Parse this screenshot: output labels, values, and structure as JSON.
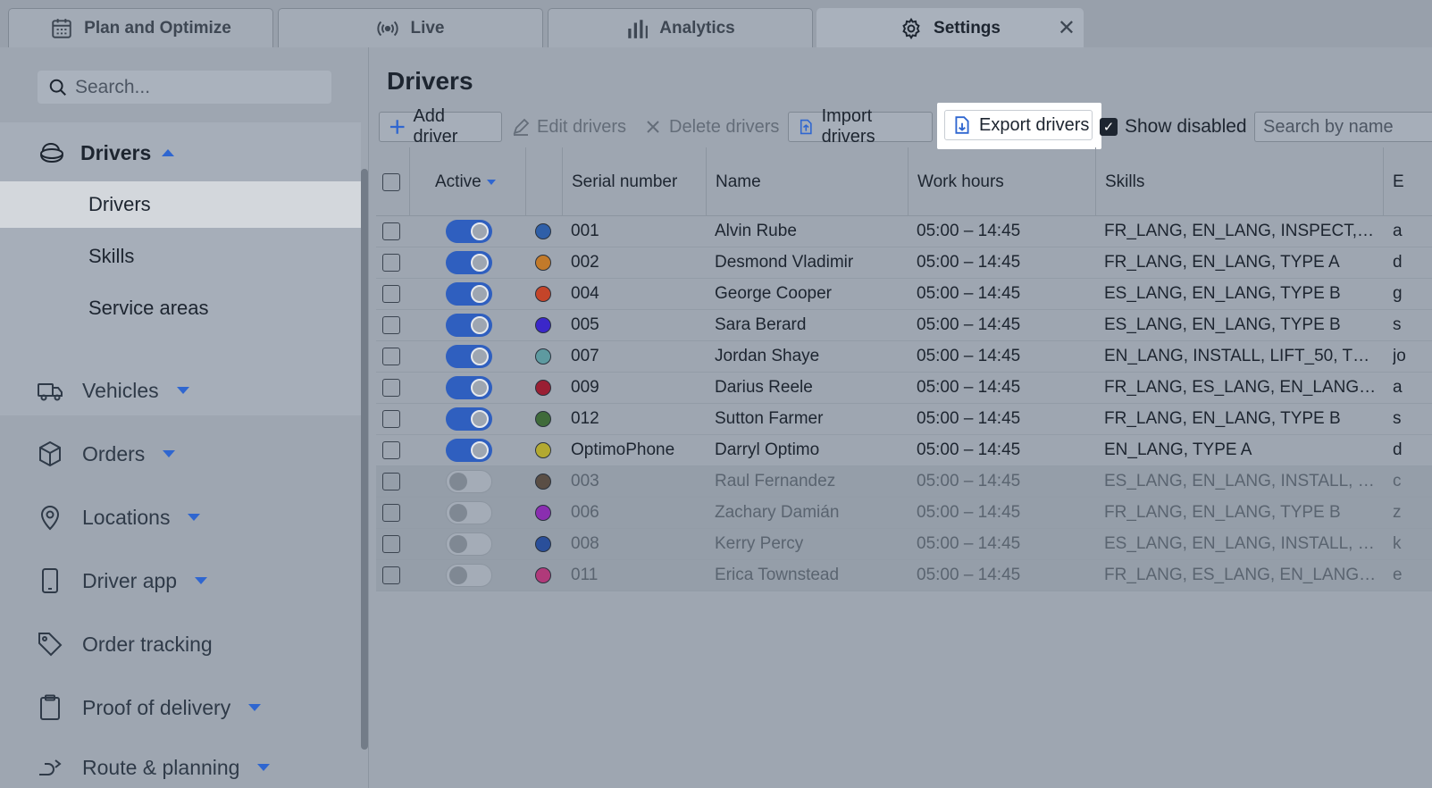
{
  "tabs": [
    {
      "label": "Plan and Optimize",
      "icon": "calendar-icon"
    },
    {
      "label": "Live",
      "icon": "broadcast-icon"
    },
    {
      "label": "Analytics",
      "icon": "bar-chart-icon"
    },
    {
      "label": "Settings",
      "icon": "gear-icon",
      "active": true,
      "close": "✕"
    }
  ],
  "sidebar": {
    "search_placeholder": "Search...",
    "group": {
      "label": "Drivers",
      "items": [
        "Drivers",
        "Skills",
        "Service areas"
      ]
    },
    "nav": [
      {
        "label": "Vehicles",
        "icon": "truck-icon"
      },
      {
        "label": "Orders",
        "icon": "box-icon"
      },
      {
        "label": "Locations",
        "icon": "map-pin-icon"
      },
      {
        "label": "Driver app",
        "icon": "phone-icon"
      },
      {
        "label": "Order tracking",
        "icon": "tag-icon"
      },
      {
        "label": "Proof of delivery",
        "icon": "clipboard-icon"
      },
      {
        "label": "Route & planning",
        "icon": "route-icon"
      }
    ]
  },
  "main": {
    "title": "Drivers",
    "toolbar": {
      "add": "Add driver",
      "edit": "Edit drivers",
      "delete": "Delete drivers",
      "import": "Import drivers",
      "export": "Export drivers",
      "show_disabled": "Show disabled",
      "search_placeholder": "Search by name"
    },
    "columns": [
      "Active",
      "Serial number",
      "Name",
      "Work hours",
      "Skills",
      "E"
    ],
    "rows": [
      {
        "active": true,
        "color": "#2f5fa8",
        "serial": "001",
        "name": "Alvin Rube",
        "hours": "05:00 – 14:45",
        "skills": "FR_LANG, EN_LANG, INSPECT,…",
        "extra": "a"
      },
      {
        "active": true,
        "color": "#c27a2a",
        "serial": "002",
        "name": "Desmond Vladimir",
        "hours": "05:00 – 14:45",
        "skills": "FR_LANG, EN_LANG, TYPE A",
        "extra": "d"
      },
      {
        "active": true,
        "color": "#c4452a",
        "serial": "004",
        "name": "George Cooper",
        "hours": "05:00 – 14:45",
        "skills": "ES_LANG, EN_LANG, TYPE B",
        "extra": "g"
      },
      {
        "active": true,
        "color": "#3b27c9",
        "serial": "005",
        "name": "Sara Berard",
        "hours": "05:00 – 14:45",
        "skills": "ES_LANG, EN_LANG, TYPE B",
        "extra": "s"
      },
      {
        "active": true,
        "color": "#5e9aa0",
        "serial": "007",
        "name": "Jordan Shaye",
        "hours": "05:00 – 14:45",
        "skills": "EN_LANG, INSTALL, LIFT_50, T…",
        "extra": "jo"
      },
      {
        "active": true,
        "color": "#9a1f33",
        "serial": "009",
        "name": "Darius Reele",
        "hours": "05:00 – 14:45",
        "skills": "FR_LANG, ES_LANG, EN_LANG…",
        "extra": "a"
      },
      {
        "active": true,
        "color": "#3f6b3a",
        "serial": "012",
        "name": "Sutton Farmer",
        "hours": "05:00 – 14:45",
        "skills": "FR_LANG, EN_LANG, TYPE B",
        "extra": "s"
      },
      {
        "active": true,
        "color": "#b3a931",
        "serial": "OptimoPhone",
        "name": "Darryl Optimo",
        "hours": "05:00 – 14:45",
        "skills": "EN_LANG, TYPE A",
        "extra": "d"
      },
      {
        "active": false,
        "color": "#5a4e45",
        "serial": "003",
        "name": "Raul Fernandez",
        "hours": "05:00 – 14:45",
        "skills": "ES_LANG, EN_LANG, INSTALL, …",
        "extra": "c"
      },
      {
        "active": false,
        "color": "#8a2eb0",
        "serial": "006",
        "name": "Zachary Damián",
        "hours": "05:00 – 14:45",
        "skills": "FR_LANG, EN_LANG, TYPE B",
        "extra": "z"
      },
      {
        "active": false,
        "color": "#2a4f9a",
        "serial": "008",
        "name": "Kerry Percy",
        "hours": "05:00 – 14:45",
        "skills": "ES_LANG, EN_LANG, INSTALL, …",
        "extra": "k"
      },
      {
        "active": false,
        "color": "#b03a7a",
        "serial": "011",
        "name": "Erica Townstead",
        "hours": "05:00 – 14:45",
        "skills": "FR_LANG, ES_LANG, EN_LANG…",
        "extra": "e"
      }
    ]
  },
  "colors": {
    "accent": "#2f66d0",
    "highlight": "#ffffff",
    "overlay": "#9ea6b1"
  }
}
